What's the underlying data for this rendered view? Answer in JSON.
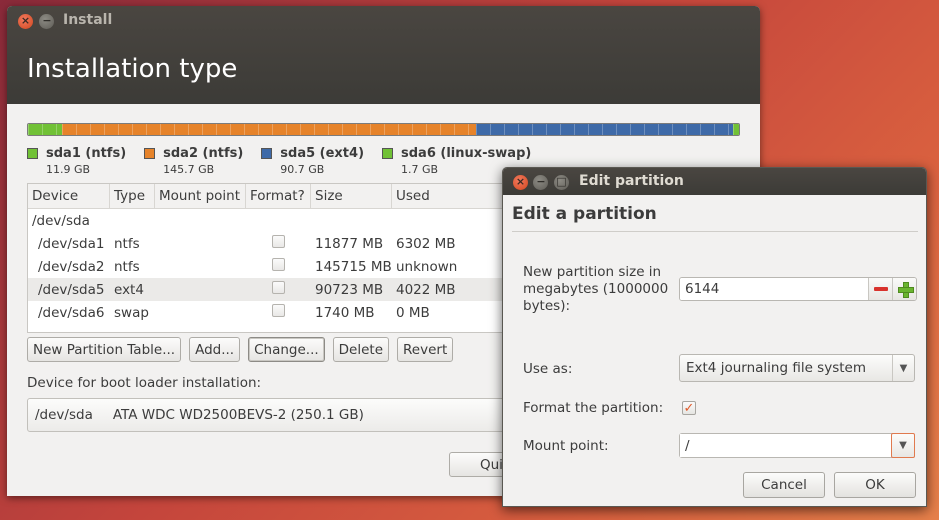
{
  "main_window": {
    "title": "Install",
    "page_title": "Installation type"
  },
  "legend": [
    {
      "name": "sda1 (ntfs)",
      "size": "11.9 GB",
      "color": "#71c136"
    },
    {
      "name": "sda2 (ntfs)",
      "size": "145.7 GB",
      "color": "#e6832a"
    },
    {
      "name": "sda5 (ext4)",
      "size": "90.7 GB",
      "color": "#3e6aa8"
    },
    {
      "name": "sda6 (linux-swap)",
      "size": "1.7 GB",
      "color": "#71c136"
    }
  ],
  "table": {
    "headers": [
      "Device",
      "Type",
      "Mount point",
      "Format?",
      "Size",
      "Used"
    ],
    "disk": "/dev/sda",
    "rows": [
      {
        "device": "/dev/sda1",
        "type": "ntfs",
        "mount": "",
        "size": "11877 MB",
        "used": "6302 MB"
      },
      {
        "device": "/dev/sda2",
        "type": "ntfs",
        "mount": "",
        "size": "145715 MB",
        "used": "unknown"
      },
      {
        "device": "/dev/sda5",
        "type": "ext4",
        "mount": "",
        "size": "90723 MB",
        "used": "4022 MB"
      },
      {
        "device": "/dev/sda6",
        "type": "swap",
        "mount": "",
        "size": "1740 MB",
        "used": "0 MB"
      }
    ]
  },
  "table_buttons": {
    "new_table": "New Partition Table...",
    "add": "Add...",
    "change": "Change...",
    "delete": "Delete",
    "revert": "Revert"
  },
  "boot": {
    "label": "Device for boot loader installation:",
    "device": "/dev/sda",
    "description": "ATA WDC WD2500BEVS-2 (250.1 GB)"
  },
  "quit_label": "Qui",
  "dialog": {
    "title": "Edit partition",
    "heading": "Edit a partition",
    "size_label": "New partition size in megabytes (1000000 bytes):",
    "size_value": "6144",
    "useas_label": "Use as:",
    "useas_value": "Ext4 journaling file system",
    "format_label": "Format the partition:",
    "format_checked": true,
    "mount_label": "Mount point:",
    "mount_value": "/",
    "cancel": "Cancel",
    "ok": "OK"
  }
}
